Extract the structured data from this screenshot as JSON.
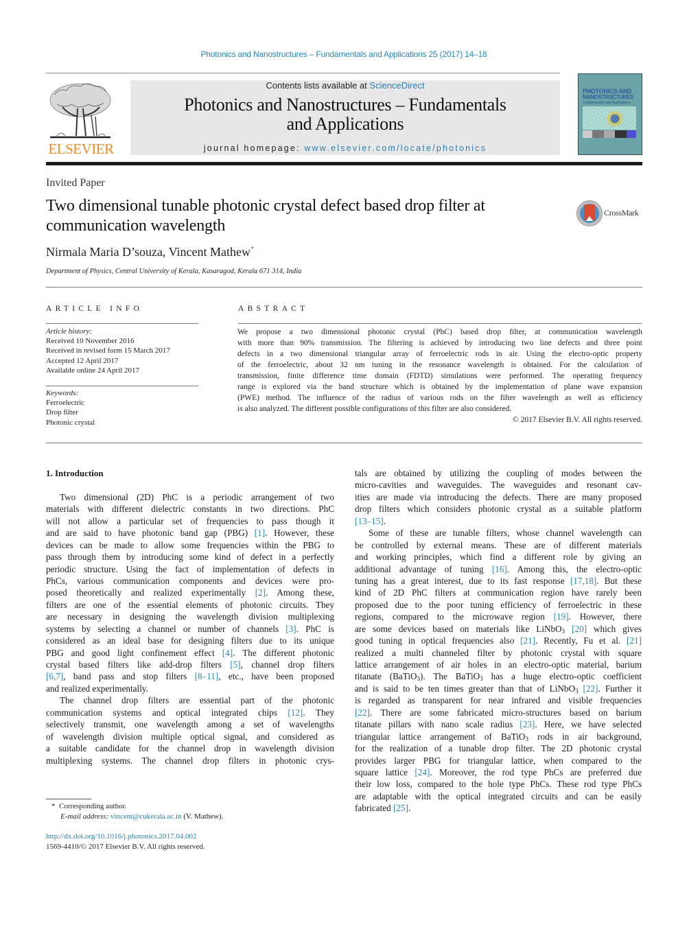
{
  "header": {
    "running_head": "Photonics and Nanostructures – Fundamentals and Applications 25 (2017) 14–18",
    "publisher_logo_text": "ELSEVIER",
    "contents_prefix": "Contents lists available at ",
    "contents_link": "ScienceDirect",
    "journal_title_line1": "Photonics and Nanostructures – Fundamentals",
    "journal_title_line2": "and Applications",
    "homepage_prefix": "journal homepage: ",
    "homepage_link": "www.elsevier.com/locate/photonics",
    "cover_title1": "PHOTONICS AND",
    "cover_title2": "NANOSTRUCTURES",
    "cover_subtitle": "Fundamentals and Applications"
  },
  "article": {
    "type": "Invited Paper",
    "title_line1": "Two dimensional tunable photonic crystal defect based drop filter at",
    "title_line2": "communication wavelength",
    "crossmark_label": "CrossMark",
    "authors": "Nirmala Maria D’souza, Vincent Mathew",
    "corresponding_mark": "*",
    "affiliation": "Department of Physics, Central University of Kerala, Kasaragod, Kerala 671 314, India"
  },
  "article_info": {
    "heading": "ARTICLE INFO",
    "history_label": "Article history:",
    "history": [
      "Received 10 November 2016",
      "Received in revised form 15 March 2017",
      "Accepted 12 April 2017",
      "Available online 24 April 2017"
    ],
    "keywords_label": "Keywords:",
    "keywords": [
      "Ferroelectric",
      "Drop filter",
      "Photonic crystal"
    ]
  },
  "abstract": {
    "heading": "ABSTRACT",
    "lines": [
      "We propose a two dimensional photonic crystal (PhC) based drop filter, at communication wavelength",
      "with more than 90% transmission. The filtering is achieved by introducing two line defects and three point",
      "defects in a two dimensional triangular array of ferroelectric rods in air. Using the electro-optic property",
      "of the ferroelectric, about 32 nm tuning in the resonance wavelength is obtained. For the calculation of",
      "transmission, finite difference time domain (FDTD) simulations were performed. The operating frequency",
      "range is explored via the band structure which is obtained by the implementation of plane wave expansion",
      "(PWE) method. The influence of the radius of various rods on the filter wavelength as well as efficiency",
      "is also analyzed. The different possible configurations of this filter are also considered."
    ],
    "copyright": "© 2017 Elsevier B.V. All rights reserved."
  },
  "body": {
    "section_heading": "1.  Introduction",
    "left_column": [
      {
        "t": "Two dimensional (2D) PhC is a periodic arrangement of two",
        "indent": true
      },
      {
        "t": "materials with different dielectric constants in two directions. PhC"
      },
      {
        "t": "will not allow a particular set of frequencies to pass though it"
      },
      {
        "t": "and are said to have photonic band gap (PBG) ",
        "cite": "[1]",
        "after": ". However, these"
      },
      {
        "t": "devices can be made to allow some frequencies within the PBG to"
      },
      {
        "t": "pass through them by introducing some kind of defect in a perfectly"
      },
      {
        "t": "periodic structure. Using the fact of implementation of defects in"
      },
      {
        "t": "PhCs, various communication components and devices were pro-"
      },
      {
        "t": "posed theoretically and realized experimentally ",
        "cite": "[2]",
        "after": ". Among these,"
      },
      {
        "t": "filters are one of the essential elements of photonic circuits. They"
      },
      {
        "t": "are necessary in designing the wavelength division multiplexing"
      },
      {
        "t": "systems by selecting a channel or number of channels ",
        "cite": "[3]",
        "after": ". PhC is"
      },
      {
        "t": "considered as an ideal base for designing filters due to its unique"
      },
      {
        "t": "PBG and good light confinement effect ",
        "cite": "[4]",
        "after": ". The different photonic"
      },
      {
        "t": "crystal based filters like add-drop filters ",
        "cite": "[5]",
        "after": ", channel drop filters"
      },
      {
        "t": "",
        "cite": "[6,7]",
        "after": ", band pass and stop filters ",
        "cite2": "[8–11]",
        "after2": ", etc., have been proposed"
      },
      {
        "t": "and realized experimentally.",
        "last": true
      },
      {
        "t": "The channel drop filters are essential part of the photonic",
        "indent": true
      },
      {
        "t": "communication systems and optical integrated chips ",
        "cite": "[12]",
        "after": ". They"
      },
      {
        "t": "selectively transmit, one wavelength among a set of wavelengths"
      },
      {
        "t": "of wavelength division multiple optical signal, and considered as"
      },
      {
        "t": "a suitable candidate for the channel drop in wavelength division"
      },
      {
        "t": "multiplexing systems. The channel drop filters in photonic crys-"
      }
    ],
    "right_column": [
      {
        "t": "tals are obtained by utilizing the coupling of modes between the"
      },
      {
        "t": "micro-cavities and waveguides. The waveguides and resonant cav-"
      },
      {
        "t": "ities are made via introducing the defects. There are many proposed"
      },
      {
        "t": "drop filters which considers photonic crystal as a suitable platform"
      },
      {
        "t": "",
        "cite": "[13–15]",
        "after": ".",
        "last": true
      },
      {
        "t": "Some of these are tunable filters, whose channel wavelength can",
        "indent": true
      },
      {
        "t": "be controlled by external means. These are of different materials"
      },
      {
        "t": "and working principles, which find a different role by giving an"
      },
      {
        "t": "additional advantage of tuning ",
        "cite": "[16]",
        "after": ". Among this, the electro-optic"
      },
      {
        "t": "tuning has a great interest, due to its fast response ",
        "cite": "[17,18]",
        "after": ". But these"
      },
      {
        "t": "kind of 2D PhC filters at communication region have rarely been"
      },
      {
        "t": "proposed due to the poor tuning efficiency of ferroelectric in these"
      },
      {
        "t": "regions, compared to the microwave region ",
        "cite": "[19]",
        "after": ". However, there"
      },
      {
        "t": "are some devices based on materials like LiNbO",
        "sub": "3",
        "sub_after": " ",
        "cite": "[20]",
        "after": " which gives"
      },
      {
        "t": "good tuning in optical frequencies also ",
        "cite": "[21]",
        "after": ". Recently, Fu et al. ",
        "cite2": "[21]"
      },
      {
        "t": "realized a multi channeled filter by photonic crystal with square"
      },
      {
        "t": "lattice arrangement of air holes in an electro-optic material, barium"
      },
      {
        "t": "titanate (BaTiO",
        "sub": "3",
        "sub_after": "). The BaTiO",
        "sub2": "3",
        "after": " has a huge electro-optic coefficient"
      },
      {
        "t": "and is said to be ten times greater than that of LiNbO",
        "sub": "3",
        "sub_after": " ",
        "cite": "[22]",
        "after": ". Further it"
      },
      {
        "t": "is regarded as transparent for near infrared and visible frequencies"
      },
      {
        "t": "",
        "cite": "[22]",
        "after": ". There are some fabricated micro-structures based on barium"
      },
      {
        "t": "titanate pillars with nano scale radius ",
        "cite": "[23]",
        "after": ". Here, we have selected"
      },
      {
        "t": "triangular lattice arrangement of BaTiO",
        "sub": "3",
        "sub_after": " rods in air background,"
      },
      {
        "t": "for the realization of a tunable drop filter. The 2D photonic crystal"
      },
      {
        "t": "provides larger PBG for triangular lattice, when compared to the"
      },
      {
        "t": "square lattice ",
        "cite": "[24]",
        "after": ". Moreover, the rod type PhCs are preferred due"
      },
      {
        "t": "their low loss, compared to the hole type PhCs. These rod type PhCs"
      },
      {
        "t": "are adaptable with the optical integrated circuits and can be easily"
      },
      {
        "t": "fabricated ",
        "cite": "[25]",
        "after": ".",
        "last": true
      }
    ]
  },
  "footnote": {
    "mark": "*",
    "corresponding": "Corresponding author.",
    "email_label": "E-mail address: ",
    "email": "vincent@cukerala.ac.in",
    "email_suffix": " (V. Mathew)."
  },
  "footer": {
    "doi": "http://dx.doi.org/10.1016/j.photonics.2017.04.002",
    "issn_copyright": "1569-4410/© 2017 Elsevier B.V. All rights reserved."
  },
  "colors": {
    "link": "#2a86b5",
    "elsevier_orange": "#f08a24",
    "masthead_bg": "#e7e7e7"
  }
}
